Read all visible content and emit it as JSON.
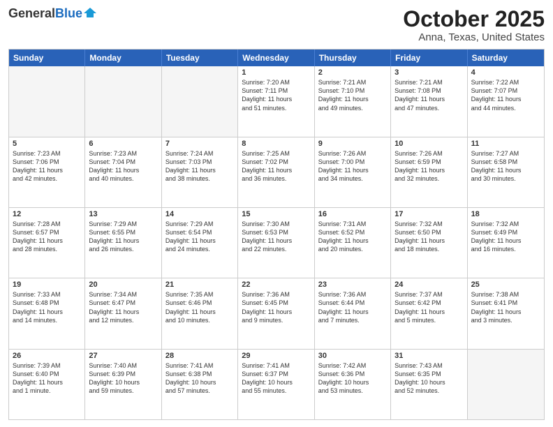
{
  "header": {
    "logo_general": "General",
    "logo_blue": "Blue",
    "month_title": "October 2025",
    "location": "Anna, Texas, United States"
  },
  "days_of_week": [
    "Sunday",
    "Monday",
    "Tuesday",
    "Wednesday",
    "Thursday",
    "Friday",
    "Saturday"
  ],
  "rows": [
    [
      {
        "day": "",
        "empty": true
      },
      {
        "day": "",
        "empty": true
      },
      {
        "day": "",
        "empty": true
      },
      {
        "day": "1",
        "lines": [
          "Sunrise: 7:20 AM",
          "Sunset: 7:11 PM",
          "Daylight: 11 hours",
          "and 51 minutes."
        ]
      },
      {
        "day": "2",
        "lines": [
          "Sunrise: 7:21 AM",
          "Sunset: 7:10 PM",
          "Daylight: 11 hours",
          "and 49 minutes."
        ]
      },
      {
        "day": "3",
        "lines": [
          "Sunrise: 7:21 AM",
          "Sunset: 7:08 PM",
          "Daylight: 11 hours",
          "and 47 minutes."
        ]
      },
      {
        "day": "4",
        "lines": [
          "Sunrise: 7:22 AM",
          "Sunset: 7:07 PM",
          "Daylight: 11 hours",
          "and 44 minutes."
        ]
      }
    ],
    [
      {
        "day": "5",
        "lines": [
          "Sunrise: 7:23 AM",
          "Sunset: 7:06 PM",
          "Daylight: 11 hours",
          "and 42 minutes."
        ]
      },
      {
        "day": "6",
        "lines": [
          "Sunrise: 7:23 AM",
          "Sunset: 7:04 PM",
          "Daylight: 11 hours",
          "and 40 minutes."
        ]
      },
      {
        "day": "7",
        "lines": [
          "Sunrise: 7:24 AM",
          "Sunset: 7:03 PM",
          "Daylight: 11 hours",
          "and 38 minutes."
        ]
      },
      {
        "day": "8",
        "lines": [
          "Sunrise: 7:25 AM",
          "Sunset: 7:02 PM",
          "Daylight: 11 hours",
          "and 36 minutes."
        ]
      },
      {
        "day": "9",
        "lines": [
          "Sunrise: 7:26 AM",
          "Sunset: 7:00 PM",
          "Daylight: 11 hours",
          "and 34 minutes."
        ]
      },
      {
        "day": "10",
        "lines": [
          "Sunrise: 7:26 AM",
          "Sunset: 6:59 PM",
          "Daylight: 11 hours",
          "and 32 minutes."
        ]
      },
      {
        "day": "11",
        "lines": [
          "Sunrise: 7:27 AM",
          "Sunset: 6:58 PM",
          "Daylight: 11 hours",
          "and 30 minutes."
        ]
      }
    ],
    [
      {
        "day": "12",
        "lines": [
          "Sunrise: 7:28 AM",
          "Sunset: 6:57 PM",
          "Daylight: 11 hours",
          "and 28 minutes."
        ]
      },
      {
        "day": "13",
        "lines": [
          "Sunrise: 7:29 AM",
          "Sunset: 6:55 PM",
          "Daylight: 11 hours",
          "and 26 minutes."
        ]
      },
      {
        "day": "14",
        "lines": [
          "Sunrise: 7:29 AM",
          "Sunset: 6:54 PM",
          "Daylight: 11 hours",
          "and 24 minutes."
        ]
      },
      {
        "day": "15",
        "lines": [
          "Sunrise: 7:30 AM",
          "Sunset: 6:53 PM",
          "Daylight: 11 hours",
          "and 22 minutes."
        ]
      },
      {
        "day": "16",
        "lines": [
          "Sunrise: 7:31 AM",
          "Sunset: 6:52 PM",
          "Daylight: 11 hours",
          "and 20 minutes."
        ]
      },
      {
        "day": "17",
        "lines": [
          "Sunrise: 7:32 AM",
          "Sunset: 6:50 PM",
          "Daylight: 11 hours",
          "and 18 minutes."
        ]
      },
      {
        "day": "18",
        "lines": [
          "Sunrise: 7:32 AM",
          "Sunset: 6:49 PM",
          "Daylight: 11 hours",
          "and 16 minutes."
        ]
      }
    ],
    [
      {
        "day": "19",
        "lines": [
          "Sunrise: 7:33 AM",
          "Sunset: 6:48 PM",
          "Daylight: 11 hours",
          "and 14 minutes."
        ]
      },
      {
        "day": "20",
        "lines": [
          "Sunrise: 7:34 AM",
          "Sunset: 6:47 PM",
          "Daylight: 11 hours",
          "and 12 minutes."
        ]
      },
      {
        "day": "21",
        "lines": [
          "Sunrise: 7:35 AM",
          "Sunset: 6:46 PM",
          "Daylight: 11 hours",
          "and 10 minutes."
        ]
      },
      {
        "day": "22",
        "lines": [
          "Sunrise: 7:36 AM",
          "Sunset: 6:45 PM",
          "Daylight: 11 hours",
          "and 9 minutes."
        ]
      },
      {
        "day": "23",
        "lines": [
          "Sunrise: 7:36 AM",
          "Sunset: 6:44 PM",
          "Daylight: 11 hours",
          "and 7 minutes."
        ]
      },
      {
        "day": "24",
        "lines": [
          "Sunrise: 7:37 AM",
          "Sunset: 6:42 PM",
          "Daylight: 11 hours",
          "and 5 minutes."
        ]
      },
      {
        "day": "25",
        "lines": [
          "Sunrise: 7:38 AM",
          "Sunset: 6:41 PM",
          "Daylight: 11 hours",
          "and 3 minutes."
        ]
      }
    ],
    [
      {
        "day": "26",
        "lines": [
          "Sunrise: 7:39 AM",
          "Sunset: 6:40 PM",
          "Daylight: 11 hours",
          "and 1 minute."
        ]
      },
      {
        "day": "27",
        "lines": [
          "Sunrise: 7:40 AM",
          "Sunset: 6:39 PM",
          "Daylight: 10 hours",
          "and 59 minutes."
        ]
      },
      {
        "day": "28",
        "lines": [
          "Sunrise: 7:41 AM",
          "Sunset: 6:38 PM",
          "Daylight: 10 hours",
          "and 57 minutes."
        ]
      },
      {
        "day": "29",
        "lines": [
          "Sunrise: 7:41 AM",
          "Sunset: 6:37 PM",
          "Daylight: 10 hours",
          "and 55 minutes."
        ]
      },
      {
        "day": "30",
        "lines": [
          "Sunrise: 7:42 AM",
          "Sunset: 6:36 PM",
          "Daylight: 10 hours",
          "and 53 minutes."
        ]
      },
      {
        "day": "31",
        "lines": [
          "Sunrise: 7:43 AM",
          "Sunset: 6:35 PM",
          "Daylight: 10 hours",
          "and 52 minutes."
        ]
      },
      {
        "day": "",
        "empty": true
      }
    ]
  ]
}
